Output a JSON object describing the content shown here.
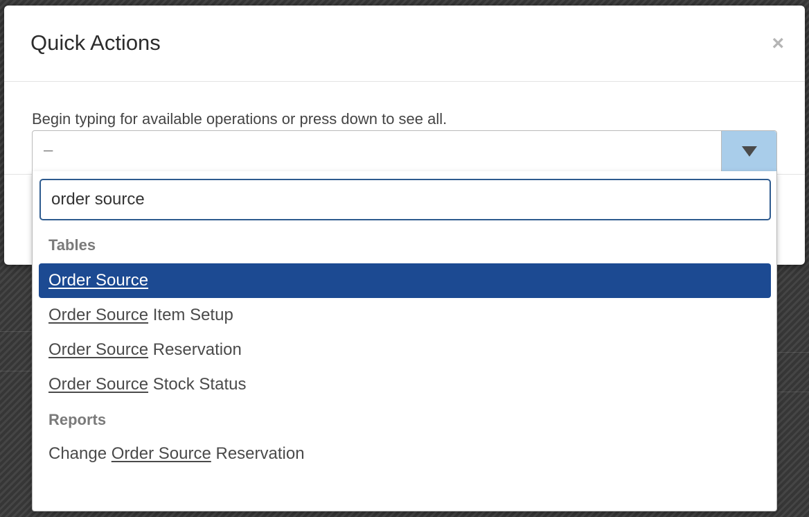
{
  "modal": {
    "title": "Quick Actions",
    "close_glyph": "×",
    "instruction": "Begin typing for available operations or press down to see all."
  },
  "select": {
    "value": "–",
    "arrow_icon": "triangle-down-icon"
  },
  "search": {
    "value": "order source"
  },
  "groups": [
    {
      "label": "Tables",
      "options": [
        {
          "match": "Order Source",
          "prefix": "",
          "suffix": "",
          "selected": true
        },
        {
          "match": "Order Source",
          "prefix": "",
          "suffix": " Item Setup",
          "selected": false
        },
        {
          "match": "Order Source",
          "prefix": "",
          "suffix": " Reservation",
          "selected": false
        },
        {
          "match": "Order Source",
          "prefix": "",
          "suffix": " Stock Status",
          "selected": false
        }
      ]
    },
    {
      "label": "Reports",
      "options": [
        {
          "match": "Order Source",
          "prefix": "Change ",
          "suffix": " Reservation",
          "selected": false
        }
      ]
    }
  ],
  "colors": {
    "selected_bg": "#1c4a92",
    "search_border": "#2d5a8e",
    "arrow_bg": "#a9cdea"
  }
}
